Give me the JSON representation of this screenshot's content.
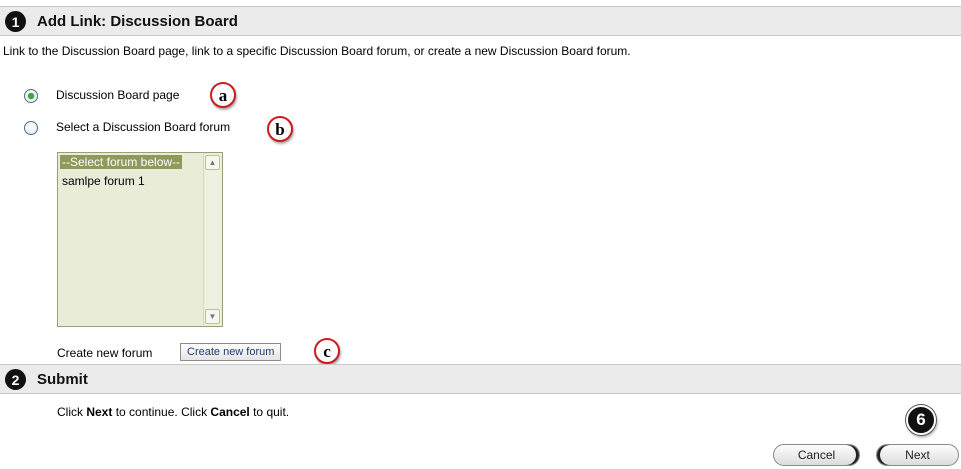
{
  "step1": {
    "number": "1",
    "title": "Add Link: Discussion Board"
  },
  "intro": "Link to the Discussion Board page, link to a specific Discussion Board forum, or create a new Discussion Board forum.",
  "options": {
    "board_page": {
      "label": "Discussion Board page",
      "checked": true,
      "callout": "a"
    },
    "select_forum": {
      "label": "Select a Discussion Board forum",
      "checked": false,
      "callout": "b"
    }
  },
  "forum_list": {
    "items": [
      "--Select forum below--",
      "samlpe forum 1"
    ],
    "selected_index": 0
  },
  "create_forum": {
    "label": "Create new forum",
    "button": "Create new forum",
    "callout": "c"
  },
  "step2": {
    "number": "2",
    "title": "Submit"
  },
  "submit": {
    "instruction_parts": [
      "Click ",
      "Next",
      " to continue. Click ",
      "Cancel",
      " to quit."
    ],
    "cancel_label": "Cancel",
    "next_label": "Next",
    "badge": "6"
  },
  "colors": {
    "header_bg": "#ebebeb",
    "callout_border": "#cc1c1c",
    "list_bg": "#e9ecd7",
    "list_selected_bg": "#8e9a5c",
    "radio_checked": "#3fa33a"
  }
}
